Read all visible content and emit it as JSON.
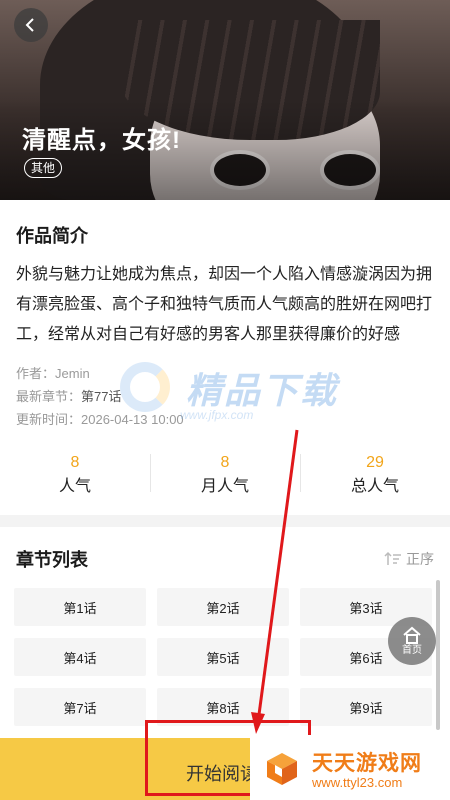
{
  "book": {
    "title": "清醒点，女孩!",
    "genre": "其他"
  },
  "intro": {
    "heading": "作品简介",
    "text": "外貌与魅力让她成为焦点，却因一个人陷入情感漩涡因为拥有漂亮脸蛋、高个子和独特气质而人气颇高的胜妍在网吧打工，经常从对自己有好感的男客人那里获得廉价的好感",
    "author_label": "作者：",
    "author": "Jemin",
    "latest_label": "最新章节：",
    "latest": "第77话",
    "updated_label": "更新时间：",
    "updated": "2026-04-13 10:00"
  },
  "watermark": {
    "text": "精品下载",
    "url": "www.jfpx.com"
  },
  "stats": [
    {
      "num": "8",
      "label": "人气"
    },
    {
      "num": "8",
      "label": "月人气"
    },
    {
      "num": "29",
      "label": "总人气"
    }
  ],
  "chapters": {
    "heading": "章节列表",
    "sort_label": "正序",
    "items": [
      "第1话",
      "第2话",
      "第3话",
      "第4话",
      "第5话",
      "第6话",
      "第7话",
      "第8话",
      "第9话"
    ]
  },
  "home": {
    "label": "首页"
  },
  "read_button": {
    "label": "开始阅读"
  },
  "site_logo": {
    "name": "天天游戏网",
    "url": "www.ttyl23.com"
  },
  "colors": {
    "accent": "#f6c945",
    "stat_num": "#f2a51a",
    "annotation": "#e0181b"
  },
  "icons": [
    "back-arrow-icon",
    "sort-icon",
    "home-icon"
  ]
}
